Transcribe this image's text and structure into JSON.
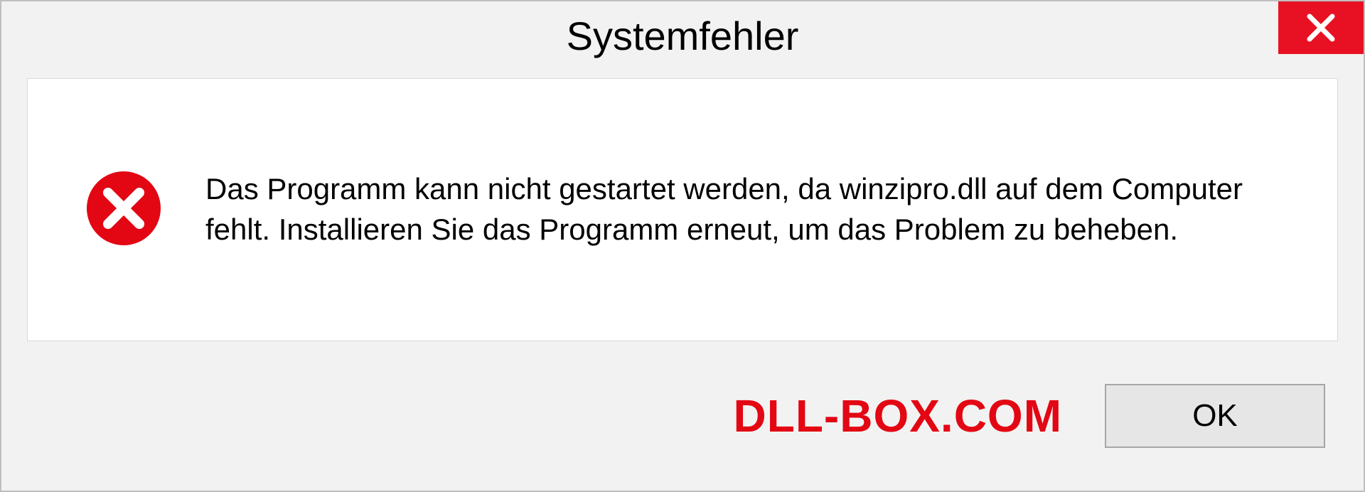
{
  "dialog": {
    "title": "Systemfehler",
    "message": "Das Programm kann nicht gestartet werden, da winzipro.dll auf dem Computer fehlt. Installieren Sie das Programm erneut, um das Problem zu beheben.",
    "ok_label": "OK",
    "watermark": "DLL-BOX.COM"
  }
}
